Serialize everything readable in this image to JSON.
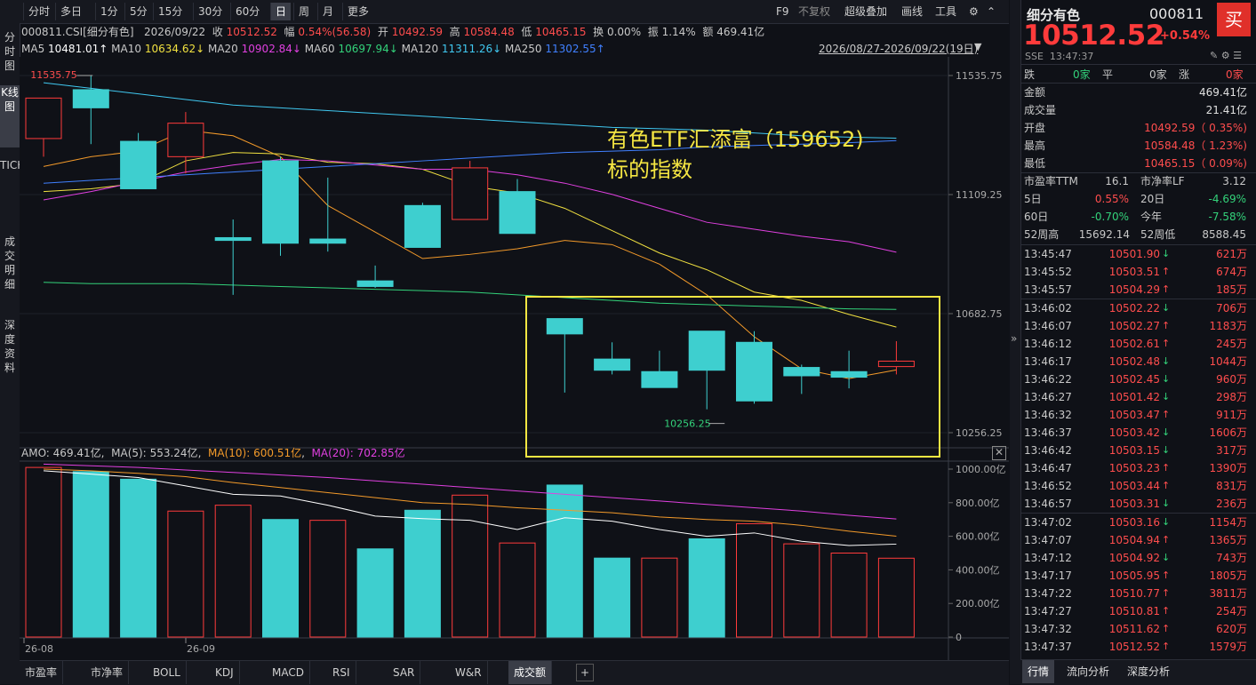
{
  "topbar": {
    "tabs": [
      "分时",
      "多日",
      "1分",
      "5分",
      "15分",
      "30分",
      "60分",
      "日",
      "周",
      "月",
      "更多"
    ],
    "active_tab": "日",
    "right_items": [
      "F9",
      "不复权",
      "超级叠加",
      "画线",
      "工具"
    ]
  },
  "leftnav": {
    "items": [
      "分时图",
      "K线图",
      "TICK",
      "成交明细",
      "深度资料"
    ],
    "active": "K线图"
  },
  "info": {
    "code_name": "000811.CSI[细分有色]",
    "date": "2026/09/22",
    "close_label": "收",
    "close": "10512.52",
    "change_label": "幅",
    "change": "0.54%(56.58)",
    "open_label": "开",
    "open": "10492.59",
    "high_label": "高",
    "high": "10584.48",
    "low_label": "低",
    "low": "10465.15",
    "turnover_label": "换",
    "turnover": "0.00%",
    "amplitude_label": "振",
    "amplitude": "1.14%",
    "amount_label": "额",
    "amount": "469.41亿"
  },
  "ma_bar": {
    "items": [
      {
        "label": "MA5",
        "value": "10481.01↑",
        "color": "#ffffff"
      },
      {
        "label": "MA10",
        "value": "10634.62↓",
        "color": "#f0e040"
      },
      {
        "label": "MA20",
        "value": "10902.84↓",
        "color": "#e040e0"
      },
      {
        "label": "MA60",
        "value": "10697.94↓",
        "color": "#33d27a"
      },
      {
        "label": "MA120",
        "value": "11311.26↓",
        "color": "#40c8f0"
      },
      {
        "label": "MA250",
        "value": "11302.55↑",
        "color": "#4080ff"
      }
    ],
    "date_range": "2026/08/27-2026/09/22(19日)"
  },
  "annotation": {
    "line1": "有色ETF汇添富（159652)",
    "line2": "标的指数",
    "color": "#f5e642"
  },
  "price_labels": {
    "max": "11535.75",
    "min": "10256.25"
  },
  "volume_info": {
    "amo_label": "AMO:",
    "amo": "469.41亿",
    "ma5_label": "MA(5):",
    "ma5": "553.24亿",
    "ma10_label": "MA(10):",
    "ma10": "600.51亿",
    "ma20_label": "MA(20):",
    "ma20": "702.85亿"
  },
  "x_labels": [
    "26-08",
    "26-09"
  ],
  "bottom_tabs": [
    "市盈率",
    "市净率",
    "BOLL",
    "KDJ",
    "MACD",
    "RSI",
    "SAR",
    "W&R",
    "成交额"
  ],
  "active_bottom_tab": "成交额",
  "panel": {
    "name": "细分有色",
    "code": "000811",
    "buy": "买",
    "price": "10512.52",
    "change_pct": "+0.54%",
    "exchange": "SSE",
    "time": "13:47:37",
    "breadth": {
      "down_label": "跌",
      "down": "0家",
      "flat_label": "平",
      "flat": "0家",
      "up_label": "涨",
      "up": "0家"
    },
    "stats": [
      {
        "label": "金额",
        "value": "469.41亿",
        "color": "#e0e0e0"
      },
      {
        "label": "成交量",
        "value": "21.41亿",
        "color": "#e0e0e0"
      },
      {
        "label": "开盘",
        "value": "10492.59（ 0.35%)",
        "color": "#ff4d4d"
      },
      {
        "label": "最高",
        "value": "10584.48（ 1.23%)",
        "color": "#ff4d4d"
      },
      {
        "label": "最低",
        "value": "10465.15（ 0.09%)",
        "color": "#ff4d4d"
      }
    ],
    "pe_label": "市盈率TTM",
    "pe": "16.1",
    "pb_label": "市净率LF",
    "pb": "3.12",
    "returns": [
      {
        "l1": "5日",
        "v1": "0.55%",
        "c1": "#ff4d4d",
        "l2": "20日",
        "v2": "-4.69%",
        "c2": "#33d27a"
      },
      {
        "l1": "60日",
        "v1": "-0.70%",
        "c1": "#33d27a",
        "l2": "今年",
        "v2": "-7.58%",
        "c2": "#33d27a"
      }
    ],
    "week52_high_label": "52周高",
    "week52_high": "15692.14",
    "week52_low_label": "52周低",
    "week52_low": "8588.45",
    "ticks": [
      {
        "t": "13:45:47",
        "p": "10501.90",
        "d": "down",
        "v": "621万"
      },
      {
        "t": "13:45:52",
        "p": "10503.51",
        "d": "up",
        "v": "674万"
      },
      {
        "t": "13:45:57",
        "p": "10504.29",
        "d": "up",
        "v": "185万"
      },
      {
        "t": "13:46:02",
        "p": "10502.22",
        "d": "down",
        "v": "706万"
      },
      {
        "t": "13:46:07",
        "p": "10502.27",
        "d": "up",
        "v": "1183万"
      },
      {
        "t": "13:46:12",
        "p": "10502.61",
        "d": "up",
        "v": "245万"
      },
      {
        "t": "13:46:17",
        "p": "10502.48",
        "d": "down",
        "v": "1044万"
      },
      {
        "t": "13:46:22",
        "p": "10502.45",
        "d": "down",
        "v": "960万"
      },
      {
        "t": "13:46:27",
        "p": "10501.42",
        "d": "down",
        "v": "298万"
      },
      {
        "t": "13:46:32",
        "p": "10503.47",
        "d": "up",
        "v": "911万"
      },
      {
        "t": "13:46:37",
        "p": "10503.42",
        "d": "down",
        "v": "1606万"
      },
      {
        "t": "13:46:42",
        "p": "10503.15",
        "d": "down",
        "v": "317万"
      },
      {
        "t": "13:46:47",
        "p": "10503.23",
        "d": "up",
        "v": "1390万"
      },
      {
        "t": "13:46:52",
        "p": "10503.44",
        "d": "up",
        "v": "831万"
      },
      {
        "t": "13:46:57",
        "p": "10503.31",
        "d": "down",
        "v": "236万"
      },
      {
        "t": "13:47:02",
        "p": "10503.16",
        "d": "down",
        "v": "1154万"
      },
      {
        "t": "13:47:07",
        "p": "10504.94",
        "d": "up",
        "v": "1365万"
      },
      {
        "t": "13:47:12",
        "p": "10504.92",
        "d": "down",
        "v": "743万"
      },
      {
        "t": "13:47:17",
        "p": "10505.95",
        "d": "up",
        "v": "1805万"
      },
      {
        "t": "13:47:22",
        "p": "10510.77",
        "d": "up",
        "v": "3811万"
      },
      {
        "t": "13:47:27",
        "p": "10510.81",
        "d": "up",
        "v": "254万"
      },
      {
        "t": "13:47:32",
        "p": "10511.62",
        "d": "up",
        "v": "620万"
      },
      {
        "t": "13:47:37",
        "p": "10512.52",
        "d": "up",
        "v": "1579万"
      }
    ],
    "tabs": [
      "行情",
      "流向分析",
      "深度分析"
    ],
    "active_tab": "行情"
  },
  "chart_data": [
    {
      "type": "candlestick",
      "title": "000811.CSI[细分有色]",
      "dates": [
        "2026/08/27",
        "2026/08/28",
        "2026/08/31",
        "2026/09/01",
        "2026/09/02",
        "2026/09/03",
        "2026/09/04",
        "2026/09/07",
        "2026/09/08",
        "2026/09/09",
        "2026/09/10",
        "2026/09/11",
        "2026/09/14",
        "2026/09/15",
        "2026/09/16",
        "2026/09/17",
        "2026/09/18",
        "2026/09/21",
        "2026/09/22"
      ],
      "open": [
        11310,
        11485,
        11300,
        11245,
        10955,
        11230,
        10950,
        10800,
        11070,
        11020,
        11120,
        10665,
        10520,
        10475,
        10620,
        10580,
        10490,
        10475,
        10493
      ],
      "high": [
        11420,
        11535.75,
        11330,
        11405,
        11020,
        11245,
        11170,
        10855,
        11080,
        11230,
        11165,
        10665,
        10580,
        10550,
        10580,
        10620,
        10500,
        10550,
        10584
      ],
      "low": [
        11245,
        11290,
        11135,
        11185,
        10750,
        10890,
        10905,
        10775,
        10925,
        11050,
        11085,
        10400,
        10465,
        10440,
        10340,
        10360,
        10395,
        10415,
        10465
      ],
      "close": [
        11455,
        11420,
        11130,
        11365,
        10945,
        10935,
        10935,
        10780,
        10920,
        11205,
        10970,
        10610,
        10480,
        10418,
        10480,
        10370,
        10460,
        10455,
        10512.52
      ],
      "ylim": [
        10256.25,
        11535.75
      ],
      "y_ticks": [
        11535.75,
        11109.25,
        10682.75,
        10256.25
      ],
      "y_tick_labels": [
        "11535.75",
        "11109.25",
        "10682.75",
        "10256.25"
      ],
      "x_tick_labels": [
        "26-08",
        "26-09"
      ],
      "ma_series": [
        {
          "name": "MA5",
          "color": "#f39a2a",
          "values": [
            11210,
            11245,
            11265,
            11340,
            11320,
            11245,
            11070,
            10975,
            10880,
            10895,
            10915,
            10945,
            10930,
            10860,
            10750,
            10600,
            10485,
            10450,
            10481.01
          ]
        },
        {
          "name": "MA10",
          "color": "#f0e040",
          "values": [
            11120,
            11130,
            11150,
            11230,
            11260,
            11255,
            11225,
            11220,
            11200,
            11140,
            11115,
            11060,
            10980,
            10900,
            10840,
            10760,
            10730,
            10680,
            10634.62
          ]
        },
        {
          "name": "MA20",
          "color": "#e040e0",
          "values": [
            11090,
            11120,
            11155,
            11190,
            11215,
            11235,
            11230,
            11215,
            11200,
            11200,
            11180,
            11150,
            11110,
            11060,
            11010,
            10985,
            10960,
            10940,
            10902.84
          ]
        },
        {
          "name": "MA60",
          "color": "#33d27a",
          "values": [
            10795,
            10790,
            10790,
            10790,
            10785,
            10780,
            10775,
            10770,
            10765,
            10760,
            10750,
            10740,
            10730,
            10720,
            10715,
            10710,
            10705,
            10700,
            10697.94
          ]
        },
        {
          "name": "MA120",
          "color": "#40c8f0",
          "values": [
            11510,
            11490,
            11470,
            11450,
            11430,
            11420,
            11410,
            11400,
            11390,
            11380,
            11370,
            11360,
            11350,
            11345,
            11340,
            11330,
            11320,
            11315,
            11311.26
          ]
        },
        {
          "name": "MA250",
          "color": "#4080ff",
          "values": [
            11150,
            11160,
            11170,
            11180,
            11190,
            11200,
            11210,
            11220,
            11230,
            11240,
            11250,
            11260,
            11265,
            11270,
            11280,
            11285,
            11290,
            11295,
            11302.55
          ]
        }
      ],
      "annotations": [
        "11535.75",
        "10256.25"
      ]
    },
    {
      "type": "bar",
      "title": "AMO",
      "unit": "亿",
      "values": [
        1010,
        985,
        940,
        750,
        785,
        700,
        695,
        525,
        755,
        845,
        560,
        905,
        470,
        470,
        585,
        675,
        555,
        500,
        469.41
      ],
      "direction": [
        "up",
        "down",
        "down",
        "up",
        "up",
        "down",
        "up",
        "down",
        "down",
        "up",
        "up",
        "down",
        "down",
        "up",
        "down",
        "up",
        "up",
        "up",
        "up"
      ],
      "ylim": [
        0,
        1000
      ],
      "y_ticks": [
        0,
        200,
        400,
        600,
        800,
        1000
      ],
      "y_tick_labels": [
        "0",
        "200.00亿",
        "400.00亿",
        "600.00亿",
        "800.00亿",
        "1000.00亿"
      ],
      "ma_series": [
        {
          "name": "MA(5)",
          "color": "#ffffff",
          "values": [
            990,
            970,
            950,
            900,
            850,
            840,
            785,
            720,
            705,
            695,
            640,
            710,
            690,
            640,
            600,
            620,
            570,
            545,
            553.24
          ]
        },
        {
          "name": "MA(10)",
          "color": "#f39a2a",
          "values": [
            1000,
            990,
            975,
            955,
            920,
            890,
            860,
            830,
            800,
            790,
            770,
            755,
            740,
            715,
            700,
            690,
            665,
            630,
            600.51
          ]
        },
        {
          "name": "MA(20)",
          "color": "#e040e0",
          "values": [
            1030,
            1020,
            1010,
            995,
            980,
            965,
            950,
            930,
            910,
            890,
            870,
            850,
            830,
            810,
            790,
            770,
            750,
            725,
            702.85
          ]
        }
      ]
    }
  ]
}
